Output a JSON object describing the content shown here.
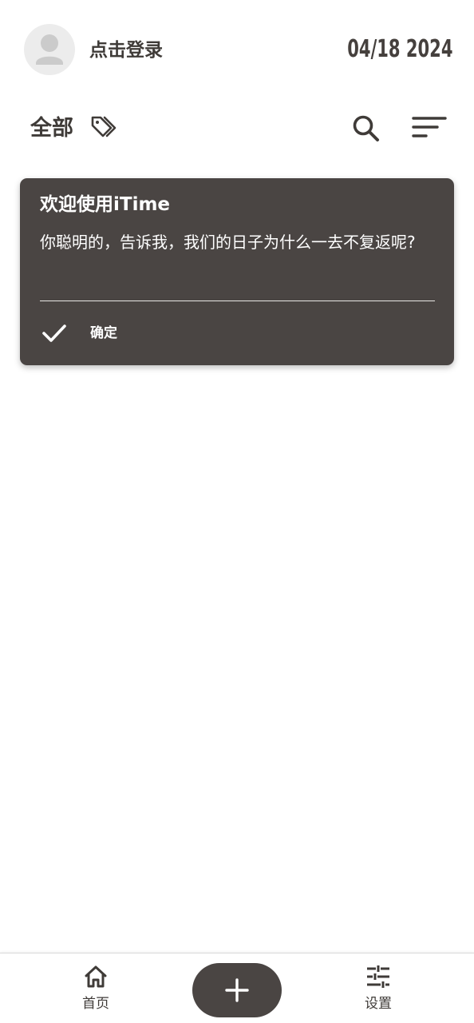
{
  "header": {
    "login_text": "点击登录",
    "date": "04/18 2024"
  },
  "filter": {
    "label": "全部",
    "icons": [
      "tag-icon",
      "search-icon",
      "sort-icon"
    ]
  },
  "card": {
    "title": "欢迎使用iTime",
    "body": "你聪明的，告诉我，我们的日子为什么一去不复返呢?",
    "confirm_label": "确定",
    "background": "#4a4543"
  },
  "bottom_nav": {
    "items": [
      {
        "label": "首页",
        "icon": "home-icon"
      },
      {
        "label": "设置",
        "icon": "sliders-icon"
      }
    ],
    "add_icon": "plus-icon"
  },
  "colors": {
    "primary_dark": "#4a4543",
    "text": "#3f3b38",
    "avatar_bg": "#ececec"
  }
}
